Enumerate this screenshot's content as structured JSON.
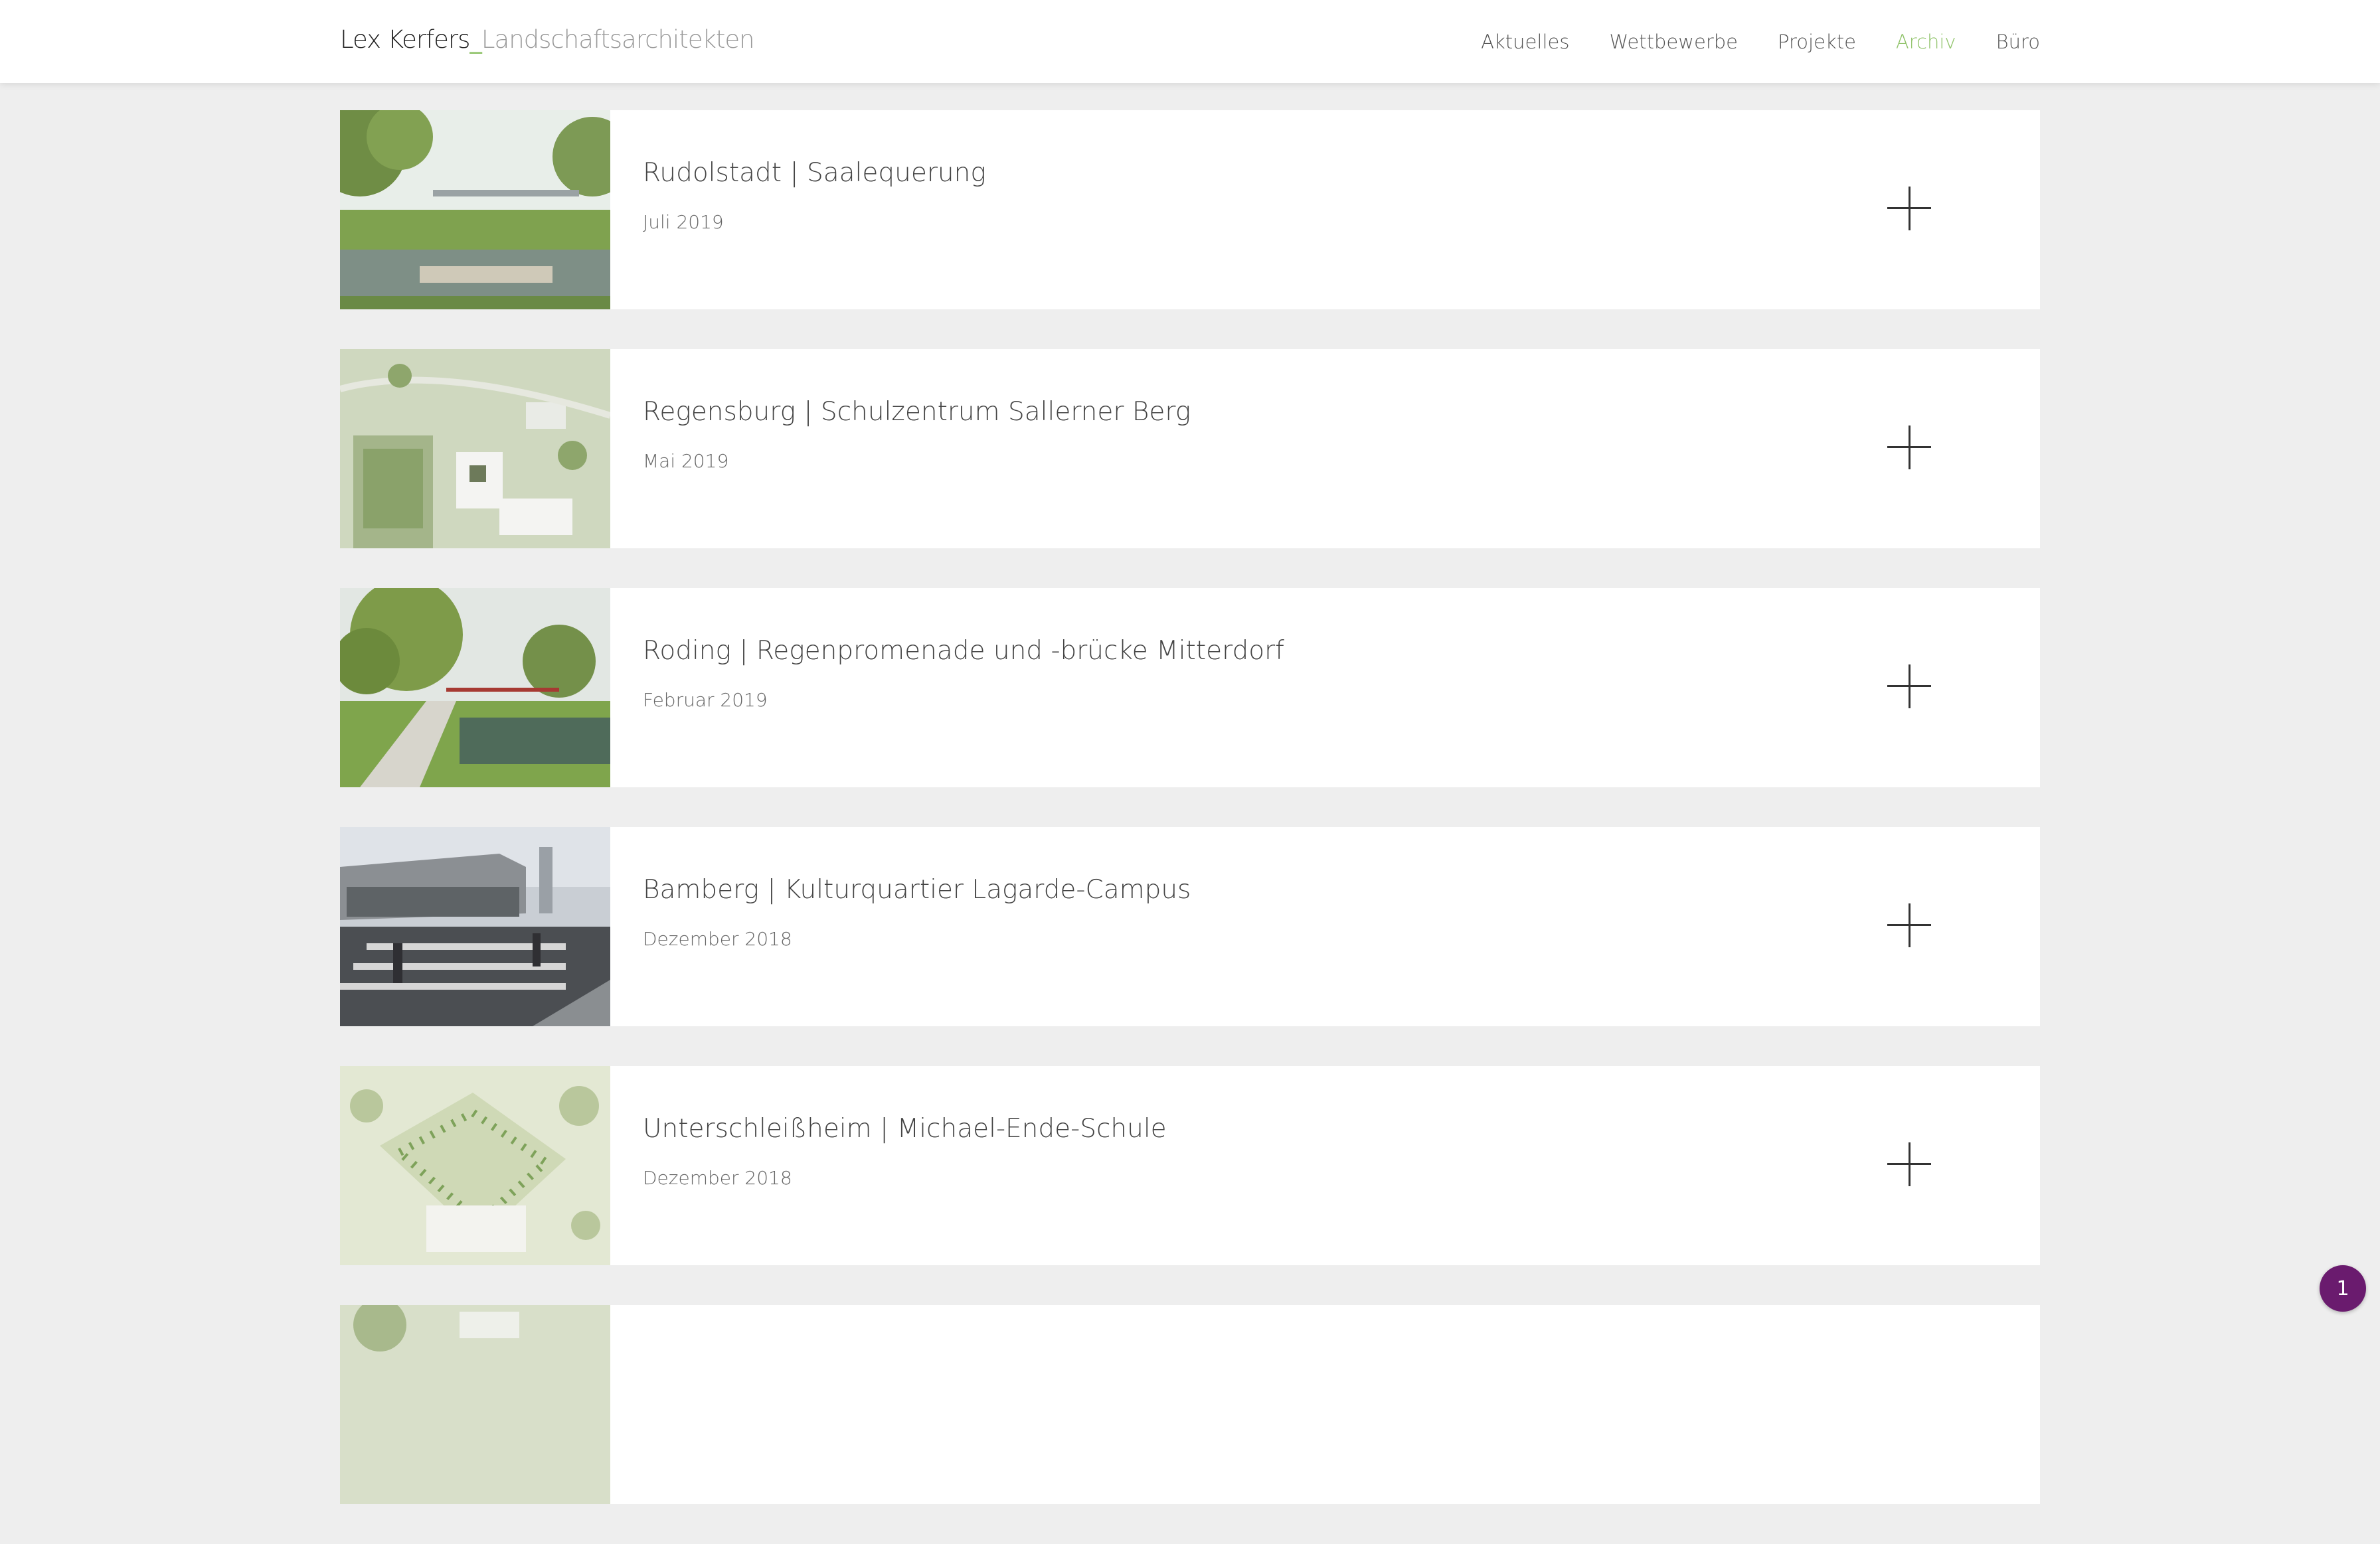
{
  "header": {
    "logo_name": "Lex Kerfers",
    "logo_sep": "_",
    "logo_sub": "Landschaftsarchitekten",
    "nav": [
      {
        "label": "Aktuelles",
        "active": false
      },
      {
        "label": "Wettbewerbe",
        "active": false
      },
      {
        "label": "Projekte",
        "active": false
      },
      {
        "label": "Archiv",
        "active": true
      },
      {
        "label": "Büro",
        "active": false
      }
    ]
  },
  "entries": [
    {
      "title": "Rudolstadt | Saalequerung",
      "date": "Juli 2019"
    },
    {
      "title": "Regensburg | Schulzentrum Sallerner Berg",
      "date": "Mai 2019"
    },
    {
      "title": "Roding | Regenpromenade und -brücke Mitterdorf",
      "date": "Februar 2019"
    },
    {
      "title": "Bamberg | Kulturquartier Lagarde-Campus",
      "date": "Dezember 2018"
    },
    {
      "title": "Unterschleißheim | Michael-Ende-Schule",
      "date": "Dezember 2018"
    },
    {
      "title": "",
      "date": ""
    }
  ],
  "badge": {
    "count": "1"
  },
  "colors": {
    "accent": "#90c36a",
    "background": "#eeeeee",
    "badge": "#6a1b6e"
  },
  "icons": {
    "expand": "plus-icon"
  }
}
